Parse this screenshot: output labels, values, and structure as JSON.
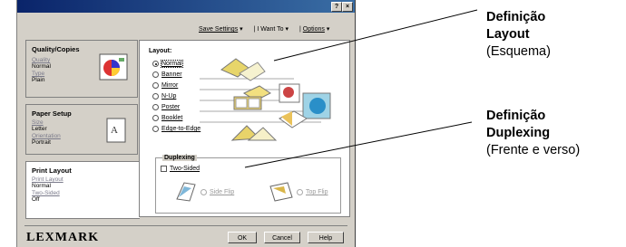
{
  "window": {
    "help_button": "?",
    "close_button": "×"
  },
  "topmenu": {
    "save_settings": "Save Settings",
    "i_want_to": "I Want To",
    "options": "Options"
  },
  "tabs": [
    {
      "title": "Quality/Copies",
      "items": [
        {
          "link": "Quality",
          "value": "Normal"
        },
        {
          "link": "Type",
          "value": "Plain"
        }
      ]
    },
    {
      "title": "Paper Setup",
      "items": [
        {
          "link": "Size",
          "value": "Letter"
        },
        {
          "link": "Orientation",
          "value": "Portrait"
        }
      ]
    },
    {
      "title": "Print Layout",
      "items": [
        {
          "link": "Print Layout",
          "value": "Normal"
        },
        {
          "link": "Two-Sided",
          "value": "Off"
        }
      ]
    }
  ],
  "layout": {
    "label": "Layout:",
    "options": [
      "Normal",
      "Banner",
      "Mirror",
      "N-Up",
      "Poster",
      "Booklet",
      "Edge-to-Edge"
    ],
    "selected": "Normal"
  },
  "duplexing": {
    "label": "Duplexing",
    "two_sided": "Two-Sided",
    "side_flip": "Side Flip",
    "top_flip": "Top Flip"
  },
  "footer": {
    "brand": "LEXMARK",
    "ok": "OK",
    "cancel": "Cancel",
    "help": "Help"
  },
  "callouts": [
    {
      "line1": "Definição",
      "line2": "Layout",
      "line3": "(Esquema)"
    },
    {
      "line1": "Definição",
      "line2": "Duplexing",
      "line3": "(Frente e verso)"
    }
  ]
}
